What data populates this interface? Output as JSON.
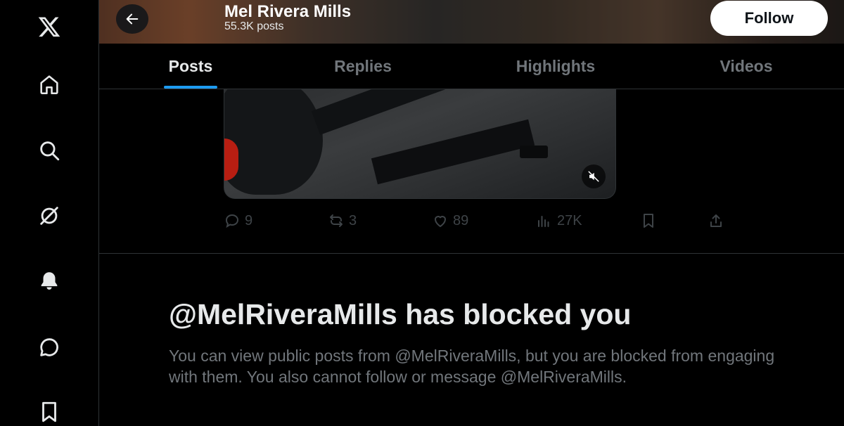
{
  "rail": {
    "items": [
      {
        "icon": "x-logo-icon"
      },
      {
        "icon": "home-icon"
      },
      {
        "icon": "search-icon"
      },
      {
        "icon": "grok-icon"
      },
      {
        "icon": "bell-icon"
      },
      {
        "icon": "message-icon"
      },
      {
        "icon": "bookmark-icon"
      }
    ]
  },
  "header": {
    "title": "Mel Rivera Mills",
    "subtitle": "55.3K posts",
    "follow_label": "Follow"
  },
  "tabs": [
    {
      "label": "Posts",
      "active": true
    },
    {
      "label": "Replies",
      "active": false
    },
    {
      "label": "Highlights",
      "active": false
    },
    {
      "label": "Videos",
      "active": false
    }
  ],
  "post": {
    "replies": "9",
    "reposts": "3",
    "likes": "89",
    "views": "27K"
  },
  "blocked": {
    "title": "@MelRiveraMills has blocked you",
    "description": "You can view public posts from @MelRiveraMills, but you are blocked from engaging with them. You also cannot follow or message @MelRiveraMills."
  },
  "colors": {
    "accent": "#1d9bf0",
    "text_primary": "#e7e9ea",
    "text_secondary": "#71767b"
  }
}
